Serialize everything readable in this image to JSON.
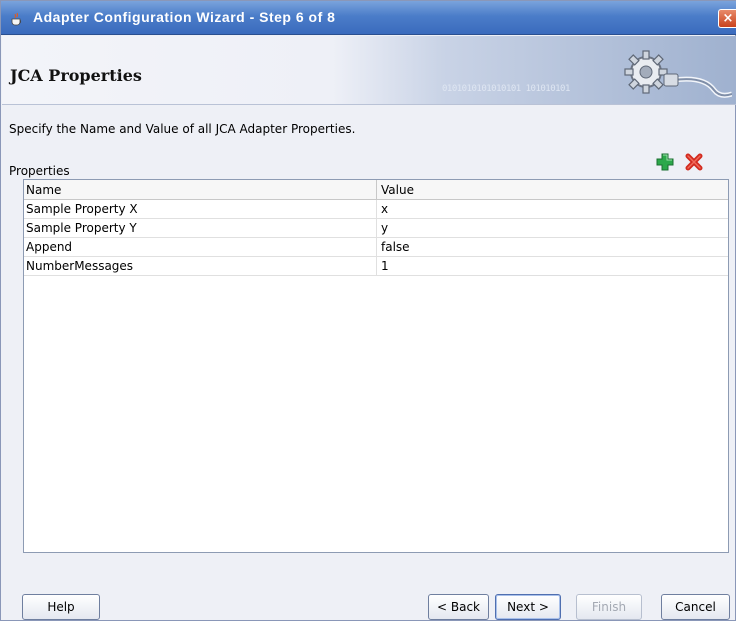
{
  "window": {
    "title": "Adapter Configuration Wizard - Step 6 of 8",
    "close_label": "×"
  },
  "header": {
    "title": "JCA Properties",
    "decor_binary": "0101010101010101 101010101"
  },
  "instructions": "Specify the Name and Value of all JCA Adapter Properties.",
  "properties": {
    "label": "Properties",
    "columns": [
      "Name",
      "Value"
    ],
    "rows": [
      {
        "name": "Sample Property X",
        "value": "x"
      },
      {
        "name": "Sample Property Y",
        "value": "y"
      },
      {
        "name": "Append",
        "value": "false"
      },
      {
        "name": "NumberMessages",
        "value": "1"
      }
    ]
  },
  "buttons": {
    "help": "Help",
    "back": "< Back",
    "next": "Next >",
    "finish": "Finish",
    "cancel": "Cancel"
  },
  "colors": {
    "add": "#2ca84a",
    "delete": "#d22a1e",
    "titlebar": "#4b7dc9"
  },
  "icons": {
    "title": "java-cup-icon",
    "add": "add-icon",
    "delete": "delete-icon",
    "header": "gear-plug-icon"
  }
}
